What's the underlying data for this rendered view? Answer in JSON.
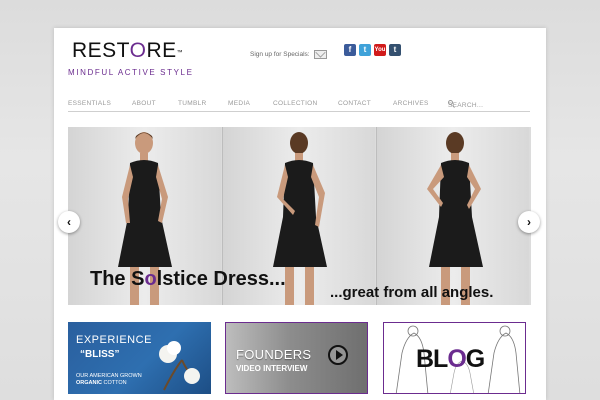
{
  "header": {
    "logo_text_pre": "REST",
    "logo_text_o": "O",
    "logo_text_post": "RE",
    "logo_tm": "™",
    "tagline": "MINDFUL ACTIVE STYLE",
    "signup_label": "Sign up for Specials:"
  },
  "social": [
    {
      "name": "facebook-icon",
      "glyph": "f"
    },
    {
      "name": "twitter-icon",
      "glyph": "t"
    },
    {
      "name": "youtube-icon",
      "glyph": "You"
    },
    {
      "name": "tumblr-icon",
      "glyph": "t"
    }
  ],
  "nav": {
    "items": [
      "ESSENTIALS",
      "ABOUT",
      "TUMBLR",
      "MEDIA",
      "COLLECTION",
      "CONTACT",
      "ARCHIVES"
    ],
    "search_placeholder": "SEARCH..."
  },
  "slider": {
    "caption_main_pre": "The S",
    "caption_main_o": "o",
    "caption_main_post": "lstice Dress...",
    "caption_sub": "...great from all angles.",
    "prev_glyph": "‹",
    "next_glyph": "›"
  },
  "promos": {
    "experience_title": "EXPERIENCE",
    "experience_bliss": "“BLISS”",
    "experience_line1": "OUR AMERICAN GROWN",
    "experience_organic": "ORGANIC",
    "experience_cotton": "COTTON",
    "founders_title": "FOUNDERS",
    "founders_sub": "VIDEO INTERVIEW",
    "blog_b": "BL",
    "blog_o": "O",
    "blog_g": "G"
  },
  "colors": {
    "brand_purple": "#6b2c8f",
    "promo_blue": "#2e6fb0"
  }
}
